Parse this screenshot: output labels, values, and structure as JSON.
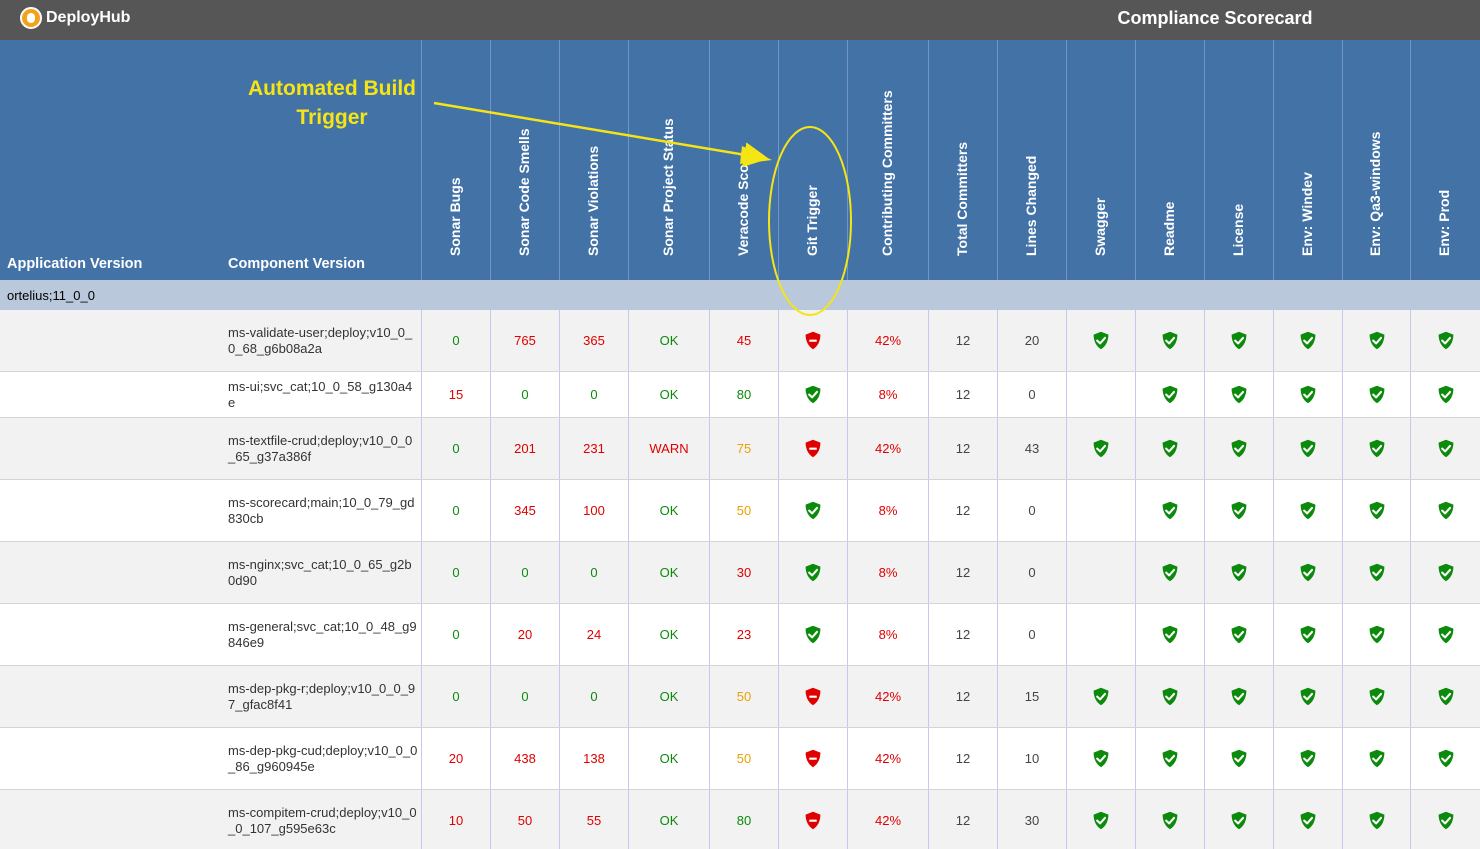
{
  "topbar": {
    "brand": "DeployHub",
    "title": "Compliance Scorecard"
  },
  "header": {
    "application_version": "Application Version",
    "component_version": "Component Version",
    "columns": [
      "Sonar Bugs",
      "Sonar Code Smells",
      "Sonar Violations",
      "Sonar Project Status",
      "Veracode Score",
      "Git Trigger",
      "Contributing Committers",
      "Total Committers",
      "Lines Changed",
      "Swagger",
      "Readme",
      "License",
      "Env: Windev",
      "Env: Qa3-windows",
      "Env: Prod"
    ]
  },
  "annotation": {
    "line1": "Automated Build",
    "line2": "Trigger"
  },
  "group": {
    "label": "ortelius;11_0_0"
  },
  "colors": {
    "ok": "#0c8a0c",
    "bad": "#e00000",
    "warn": "#e8a300",
    "header": "#4372a7",
    "topbar": "#565656"
  },
  "rows": [
    {
      "component": "ms-validate-user;deploy;v10_0_0_68_g6b08a2a",
      "sonar_bugs": "0",
      "code_smells": "765",
      "violations": "365",
      "project_status": "OK",
      "veracode": "45",
      "git_trigger": "fail",
      "contributing": "42%",
      "total": "12",
      "lines": "20",
      "swagger": "pass",
      "readme": "pass",
      "license": "pass",
      "windev": "pass",
      "qa3": "pass",
      "prod": "pass"
    },
    {
      "component": "ms-ui;svc_cat;10_0_58_g130a4e",
      "sonar_bugs": "15",
      "code_smells": "0",
      "violations": "0",
      "project_status": "OK",
      "veracode": "80",
      "git_trigger": "pass",
      "contributing": "8%",
      "total": "12",
      "lines": "0",
      "swagger": "",
      "readme": "pass",
      "license": "pass",
      "windev": "pass",
      "qa3": "pass",
      "prod": "pass"
    },
    {
      "component": "ms-textfile-crud;deploy;v10_0_0_65_g37a386f",
      "sonar_bugs": "0",
      "code_smells": "201",
      "violations": "231",
      "project_status": "WARN",
      "veracode": "75",
      "git_trigger": "fail",
      "contributing": "42%",
      "total": "12",
      "lines": "43",
      "swagger": "pass",
      "readme": "pass",
      "license": "pass",
      "windev": "pass",
      "qa3": "pass",
      "prod": "pass"
    },
    {
      "component": "ms-scorecard;main;10_0_79_gd830cb",
      "sonar_bugs": "0",
      "code_smells": "345",
      "violations": "100",
      "project_status": "OK",
      "veracode": "50",
      "git_trigger": "pass",
      "contributing": "8%",
      "total": "12",
      "lines": "0",
      "swagger": "",
      "readme": "pass",
      "license": "pass",
      "windev": "pass",
      "qa3": "pass",
      "prod": "pass"
    },
    {
      "component": "ms-nginx;svc_cat;10_0_65_g2b0d90",
      "sonar_bugs": "0",
      "code_smells": "0",
      "violations": "0",
      "project_status": "OK",
      "veracode": "30",
      "git_trigger": "pass",
      "contributing": "8%",
      "total": "12",
      "lines": "0",
      "swagger": "",
      "readme": "pass",
      "license": "pass",
      "windev": "pass",
      "qa3": "pass",
      "prod": "pass"
    },
    {
      "component": "ms-general;svc_cat;10_0_48_g9846e9",
      "sonar_bugs": "0",
      "code_smells": "20",
      "violations": "24",
      "project_status": "OK",
      "veracode": "23",
      "git_trigger": "pass",
      "contributing": "8%",
      "total": "12",
      "lines": "0",
      "swagger": "",
      "readme": "pass",
      "license": "pass",
      "windev": "pass",
      "qa3": "pass",
      "prod": "pass"
    },
    {
      "component": "ms-dep-pkg-r;deploy;v10_0_0_97_gfac8f41",
      "sonar_bugs": "0",
      "code_smells": "0",
      "violations": "0",
      "project_status": "OK",
      "veracode": "50",
      "git_trigger": "fail",
      "contributing": "42%",
      "total": "12",
      "lines": "15",
      "swagger": "pass",
      "readme": "pass",
      "license": "pass",
      "windev": "pass",
      "qa3": "pass",
      "prod": "pass"
    },
    {
      "component": "ms-dep-pkg-cud;deploy;v10_0_0_86_g960945e",
      "sonar_bugs": "20",
      "code_smells": "438",
      "violations": "138",
      "project_status": "OK",
      "veracode": "50",
      "git_trigger": "fail",
      "contributing": "42%",
      "total": "12",
      "lines": "10",
      "swagger": "pass",
      "readme": "pass",
      "license": "pass",
      "windev": "pass",
      "qa3": "pass",
      "prod": "pass"
    },
    {
      "component": "ms-compitem-crud;deploy;v10_0_0_107_g595e63c",
      "sonar_bugs": "10",
      "code_smells": "50",
      "violations": "55",
      "project_status": "OK",
      "veracode": "80",
      "git_trigger": "fail",
      "contributing": "42%",
      "total": "12",
      "lines": "30",
      "swagger": "pass",
      "readme": "pass",
      "license": "pass",
      "windev": "pass",
      "qa3": "pass",
      "prod": "pass"
    }
  ]
}
